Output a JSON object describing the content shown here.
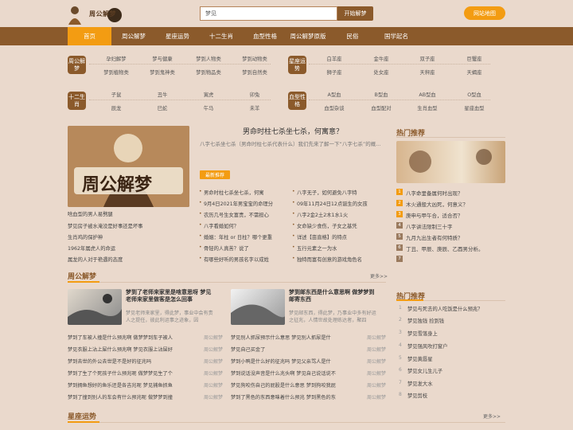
{
  "header": {
    "logo_text": "周公解梦",
    "search_value": "梦见",
    "search_button": "开始解梦",
    "sitemap_button": "网站地图"
  },
  "nav": [
    "首页",
    "周公解梦",
    "星座运势",
    "十二生肖",
    "血型性格",
    "周公解梦原版",
    "民俗",
    "国学起名"
  ],
  "cats": {
    "dream": {
      "label": "周公解梦",
      "links": [
        "孕妇解梦",
        "梦与健康",
        "梦到人物类",
        "梦到动物类",
        "梦到植物类",
        "梦到鬼神类",
        "梦到物品类",
        "梦到自然类"
      ]
    },
    "star": {
      "label": "星座运势",
      "links": [
        "白羊座",
        "金牛座",
        "双子座",
        "巨蟹座",
        "狮子座",
        "处女座",
        "天秤座",
        "天蝎座"
      ]
    },
    "zodiac": {
      "label": "十二生肖",
      "links": [
        "子鼠",
        "丑牛",
        "寅虎",
        "卯兔",
        "辰龙",
        "巳蛇",
        "午马",
        "未羊"
      ]
    },
    "blood": {
      "label": "血型性格",
      "links": [
        "A型血",
        "B型血",
        "AB型血",
        "O型血",
        "血型杂谈",
        "血型配对",
        "生肖血型",
        "星座血型"
      ]
    }
  },
  "feature": {
    "title": "男命时柱七杀坐七杀，何寓意？",
    "desc": "八字七杀坐七杀（男命时柱七杀代表什么）我们先来了解一下“八字七杀”的概...",
    "badge": "最新推荐",
    "img_text": "周公解梦",
    "left_list": [
      "啥血型的男人易劈腿",
      "梦见房子被水淹没是好事还是坏事",
      "生肖鸡的保护神",
      "1962年属虎人的命运",
      "属龙的人对于艳遇的态度"
    ],
    "mid_col1": [
      "男命时柱七杀坐七杀，何寓",
      "9月4日2021年男宝宝的命理分",
      "农历几号生女富贵，不需担心",
      "八字看婚如何？",
      "婚姻：年柱 or 日柱？哪个更重",
      "骨轻的人真苦？说了",
      "有哪些好听的男孩名字以成姓"
    ],
    "mid_col2": [
      "八字无子，如何避免八字特",
      "09年11月24日12点诞生的女孩",
      "八字2金2土2木1水1火",
      "女命缺少食伤，子女之基凭",
      "详述【亩直格】的特点",
      "五行元素之一为水",
      "独特而富有创意的游戏角色名"
    ]
  },
  "hot": {
    "title": "热门推荐",
    "items": [
      "八字命里备属何时出现？",
      "木火通般大凶死，何意义？",
      "庚申与甲午合，适合否？",
      "八字讲法限制三十字",
      "九月九出生者有何特质？",
      "丁丑、甲辰、庚辰、乙酉男分析。"
    ]
  },
  "dream_section": {
    "title": "周公解梦",
    "more": "更多>>",
    "art1_title": "梦到了老师来家里是啥意思呀 梦见老师来家里做客是怎么回事",
    "art1_desc": "梦见老师来家里，得此梦，事业中会有贵人之提任，彼此利运事之迹象，因",
    "art2_title": "梦到邮东西是什么意思啊 做梦梦到邮寄东西",
    "art2_desc": "梦见邮东西，得此梦，乃事业中多有好运之征兆，人情世故处理练达者，聚四",
    "rows_left": [
      "梦到了车被人撞是什么预兆啊 做梦梦到车子被人",
      "梦见衣服上沾上屎什么预兆啊 梦见衣服上沾屎好",
      "梦到去世的外公去世是不是好的征兆吗",
      "梦到了生了个死孩子什么预兆呢 做梦梦见生了个",
      "梦到拥鱼想好的鱼乐还是各吉兆呢 梦见捕鱼抓鱼",
      "梦到了撞到别人的车会有什么预兆呢 做梦梦到撞"
    ],
    "rows_right": [
      "梦见别人抓尿预示什么意思 梦见别人抓尿是什",
      "梦见自己买金了",
      "梦到小鸭是什么好的征兆吗 梦见父亲骂人是什",
      "梦到说话没声音是什么兆头啊 梦见自己说话说不",
      "梦见狗咬伤自己的屁股是什么意思 梦到狗咬我屁",
      "梦到了黑色的东西意味着什么预兆 梦到黑色的东"
    ],
    "tag": "周公解梦",
    "hot_title": "热门推荐",
    "hot_items": [
      "梦见与死去的人吃饭是什么预兆？",
      "梦见独钱 捡到钱",
      "梦见雪落身上",
      "梦见强风吹打窗户",
      "梦见黄唇星",
      "梦见女儿生儿子",
      "梦见发大水",
      "梦见剪枝"
    ]
  },
  "star_section": {
    "title": "星座运势",
    "more": "更多>>"
  }
}
